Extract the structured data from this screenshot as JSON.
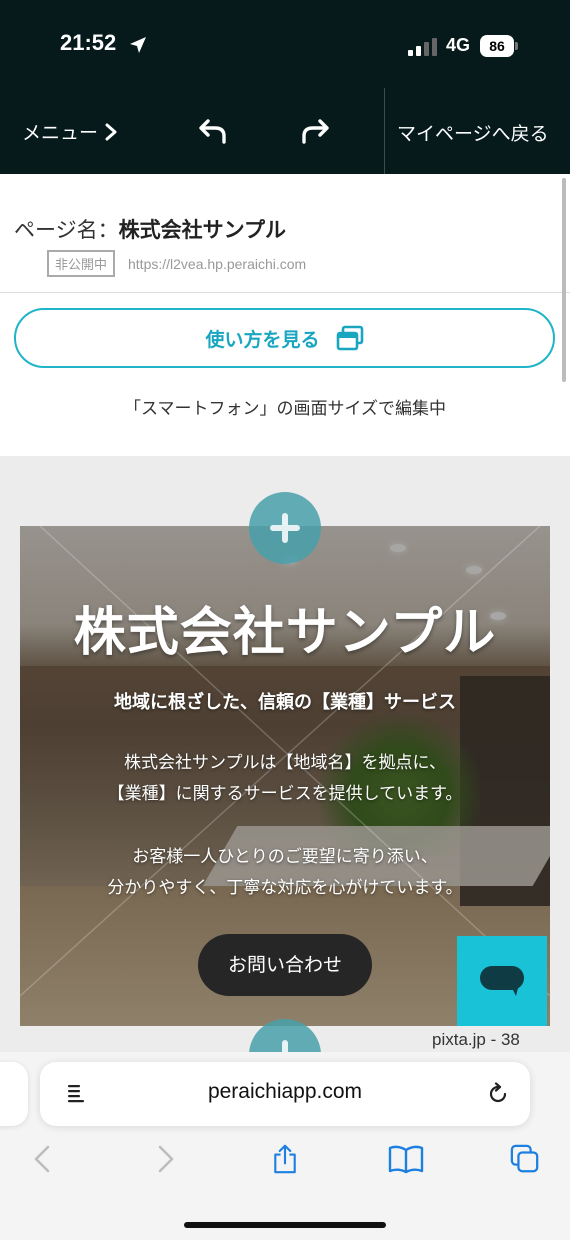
{
  "status_bar": {
    "time": "21:52",
    "network": "4G",
    "battery": "86"
  },
  "toolbar": {
    "menu_label": "メニュー",
    "mypage_label": "マイページへ戻る"
  },
  "page_info": {
    "name_prefix": "ページ名：",
    "name_value": "株式会社サンプル",
    "status_badge": "非公開中",
    "url": "https://l2vea.hp.peraichi.com",
    "howto_label": "使い方を見る",
    "edit_mode": "「スマートフォン」の画面サイズで編集中"
  },
  "hero": {
    "title": "株式会社サンプル",
    "subtitle": "地域に根ざした、信頼の【業種】サービス",
    "para1_line1": "株式会社サンプルは【地域名】を拠点に、",
    "para1_line2": "【業種】に関するサービスを提供しています。",
    "para2_line1": "お客様一人ひとりのご要望に寄り添い、",
    "para2_line2": "分かりやすく、丁寧な対応を心がけています。",
    "contact_label": "お問い合わせ",
    "credit": "pixta.jp - 38"
  },
  "safari": {
    "address": "peraichiapp.com"
  },
  "icons": {
    "location": "location-arrow-icon",
    "signal": "signal-bars-icon",
    "menu_chevron": "chevron-right-icon",
    "undo": "undo-icon",
    "redo": "redo-icon",
    "howto": "window-stack-icon",
    "add": "plus-icon",
    "chat": "chat-bubble-icon",
    "reader": "reader-icon",
    "reload": "reload-icon",
    "back": "chevron-left-icon",
    "forward": "chevron-right-icon",
    "share": "share-icon",
    "bookmarks": "book-icon",
    "tabs": "tabs-icon"
  },
  "colors": {
    "toolbar_bg": "#061a1c",
    "accent": "#1fb4c8",
    "chat_button": "#1ac2d8",
    "add_button": "#48a0aa",
    "contact_button": "#262626",
    "canvas_bg": "#ececec"
  }
}
